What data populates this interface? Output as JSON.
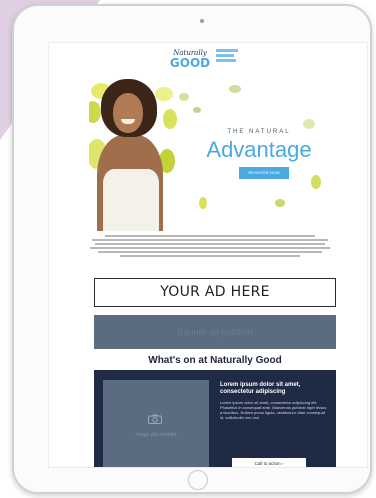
{
  "newsletter": {
    "logo": {
      "line1": "Naturally",
      "line2": "GOOD"
    },
    "hero": {
      "kicker": "THE NATURAL",
      "title": "Advantage",
      "button_label": "REGISTER NOW"
    },
    "ad_slot": {
      "label": "YOUR AD HERE"
    },
    "banner": {
      "label": "Banner ad position"
    },
    "section_title": "What's on at Naturally Good",
    "feature": {
      "heading": "Lorem ipsum dolor sit amet, consectetur adipiscing",
      "body": "Lorem ipsum dolor sit amet, consectetur adipiscing elit. Phasellus in consequat ante. Maecenas pulvinar eget lectus a faucibus. Nullam purus ligula, vestibulum vitae consequat id, sollicitudin nec orci.",
      "image_caption": "Image placeholder",
      "button_label": "Call to action ›"
    }
  },
  "colors": {
    "accent_blue": "#4ba9e2",
    "navy": "#1f2a45",
    "slate": "#5b6b80",
    "background_lilac": "#e0cfe2"
  },
  "icons": [
    "camera-icon"
  ]
}
